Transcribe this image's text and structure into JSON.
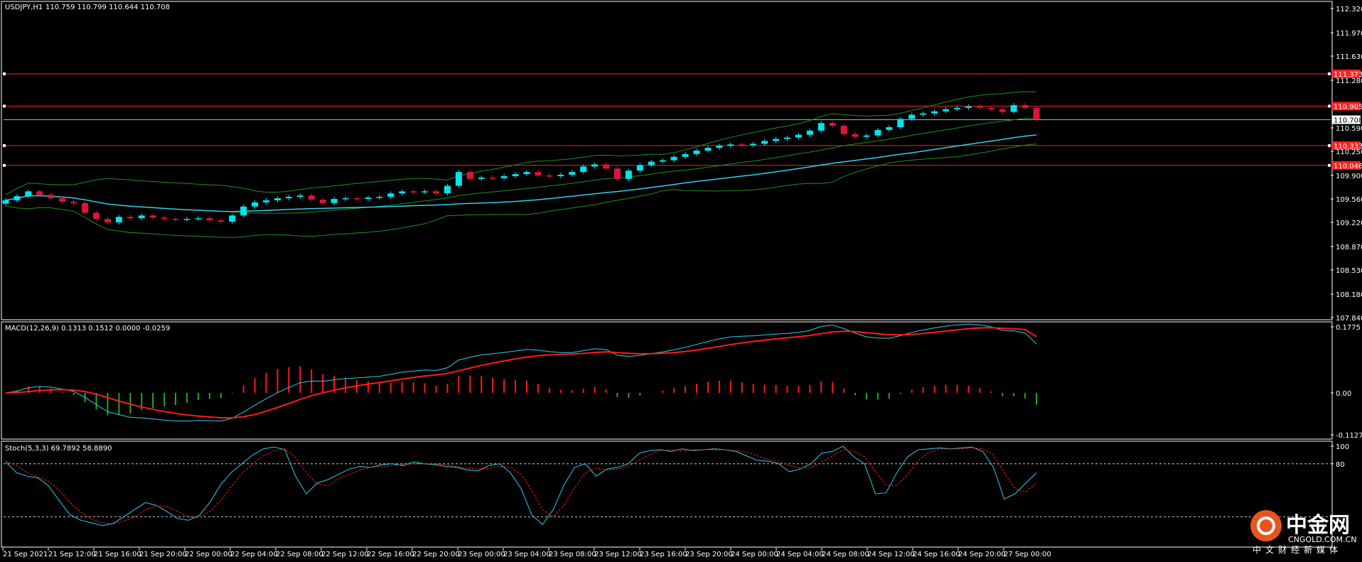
{
  "colors": {
    "background": "#000000",
    "frame": "#ffffff",
    "bull_candle": "#00e5ee",
    "bear_candle": "#dc143c",
    "ma_line": "#33ccee",
    "bands": "#1f8f1f",
    "hline": "#ff2020",
    "current_line": "#9fb8c8",
    "macd_main": "#33ccee",
    "macd_signal": "#ff1a1a",
    "hist_pos": "#ff1a1a",
    "hist_neg": "#1faa1f",
    "stoch_main": "#33ccee",
    "stoch_signal": "#ff1a1a",
    "watermark_accent": "#e8541c"
  },
  "header": {
    "symbol_label": "USDJPY,H1",
    "ohlc_label": "110.759 110.799 110.644 110.708"
  },
  "macd_panel": {
    "label": "MACD(12,26,9) 0.1313 0.1512 0.0000 -0.0259"
  },
  "stoch_panel": {
    "label": "Stoch(5,3,3) 69.7892 58.8890"
  },
  "watermark": {
    "name": "中金网",
    "domain": "CNGOLD.COM.CN",
    "sub": "中文财经新媒体"
  },
  "chart_data": [
    {
      "type": "candlestick",
      "title": "USDJPY,H1",
      "ylim": [
        107.84,
        112.32
      ],
      "y_ticks": [
        "112.320",
        "111.970",
        "111.630",
        "111.280",
        "110.590",
        "110.250",
        "109.900",
        "109.560",
        "109.220",
        "108.870",
        "108.530",
        "108.180",
        "107.840"
      ],
      "x_ticks": [
        "21 Sep 2021",
        "21 Sep 12:00",
        "21 Sep 16:00",
        "21 Sep 20:00",
        "22 Sep 00:00",
        "22 Sep 04:00",
        "22 Sep 08:00",
        "22 Sep 12:00",
        "22 Sep 16:00",
        "22 Sep 20:00",
        "23 Sep 00:00",
        "23 Sep 04:00",
        "23 Sep 08:00",
        "23 Sep 12:00",
        "23 Sep 16:00",
        "23 Sep 20:00",
        "24 Sep 00:00",
        "24 Sep 04:00",
        "24 Sep 08:00",
        "24 Sep 12:00",
        "24 Sep 16:00",
        "24 Sep 20:00",
        "27 Sep 00:00"
      ],
      "current_price": 110.708,
      "current_price_label": "110.708",
      "horizontal_levels": [
        {
          "value": 111.373,
          "label": "111.373"
        },
        {
          "value": 110.905,
          "label": "110.905"
        },
        {
          "value": 110.333,
          "label": "110.333"
        },
        {
          "value": 110.046,
          "label": "110.046"
        }
      ],
      "close": [
        109.54,
        109.6,
        109.67,
        109.62,
        109.57,
        109.52,
        109.5,
        109.36,
        109.27,
        109.22,
        109.3,
        109.28,
        109.32,
        109.29,
        109.27,
        109.26,
        109.27,
        109.28,
        109.25,
        109.23,
        109.32,
        109.45,
        109.51,
        109.54,
        109.57,
        109.59,
        109.61,
        109.55,
        109.5,
        109.56,
        109.57,
        109.56,
        109.58,
        109.59,
        109.64,
        109.67,
        109.66,
        109.67,
        109.64,
        109.75,
        109.95,
        109.85,
        109.87,
        109.86,
        109.89,
        109.92,
        109.95,
        109.9,
        109.89,
        109.91,
        109.95,
        110.03,
        110.06,
        110.0,
        109.85,
        109.97,
        110.05,
        110.1,
        110.12,
        110.17,
        110.21,
        110.26,
        110.3,
        110.33,
        110.35,
        110.34,
        110.36,
        110.4,
        110.43,
        110.45,
        110.49,
        110.55,
        110.66,
        110.62,
        110.5,
        110.46,
        110.48,
        110.56,
        110.6,
        110.72,
        110.78,
        110.8,
        110.83,
        110.86,
        110.88,
        110.9,
        110.88,
        110.86,
        110.82,
        110.92,
        110.88,
        110.708
      ]
    },
    {
      "type": "macd",
      "title": "MACD(12,26,9)",
      "values": {
        "main": 0.1313,
        "signal": 0.1512,
        "histogram": -0.0259
      },
      "y_ticks": [
        "0.1775",
        "0.00",
        "-0.1127"
      ],
      "ylim": [
        -0.1127,
        0.1775
      ]
    },
    {
      "type": "stochastic",
      "title": "Stoch(5,3,3)",
      "values": {
        "main": 69.7892,
        "signal": 58.889
      },
      "y_ticks": [
        "100",
        "80"
      ],
      "levels": [
        80,
        20
      ],
      "ylim": [
        0,
        100
      ],
      "main": [
        82,
        70,
        66,
        64,
        55,
        38,
        22,
        16,
        13,
        10,
        12,
        20,
        28,
        36,
        33,
        26,
        18,
        16,
        21,
        36,
        56,
        70,
        80,
        90,
        97,
        99,
        96,
        66,
        46,
        58,
        62,
        68,
        74,
        77,
        76,
        79,
        80,
        78,
        82,
        80,
        79,
        77,
        76,
        73,
        72,
        78,
        80,
        70,
        52,
        22,
        11,
        28,
        56,
        76,
        80,
        66,
        74,
        76,
        80,
        92,
        95,
        96,
        94,
        97,
        95,
        96,
        97,
        96,
        94,
        89,
        84,
        83,
        80,
        71,
        74,
        80,
        92,
        94,
        100,
        88,
        80,
        46,
        47,
        70,
        88,
        96,
        97,
        98,
        97,
        98,
        99,
        94,
        76,
        40,
        46,
        58,
        69.79
      ],
      "signal": [
        83,
        78,
        70,
        65,
        60,
        50,
        36,
        25,
        17,
        13,
        12,
        15,
        20,
        28,
        32,
        32,
        26,
        20,
        19,
        26,
        38,
        54,
        69,
        80,
        89,
        95,
        97,
        87,
        70,
        57,
        55,
        63,
        68,
        73,
        76,
        77,
        78,
        79,
        80,
        80,
        80,
        79,
        77,
        75,
        74,
        75,
        77,
        76,
        68,
        50,
        28,
        20,
        33,
        53,
        70,
        75,
        73,
        74,
        77,
        84,
        91,
        95,
        96,
        95,
        96,
        96,
        96,
        96,
        95,
        93,
        89,
        85,
        82,
        78,
        75,
        76,
        82,
        89,
        96,
        94,
        88,
        71,
        56,
        55,
        68,
        84,
        93,
        97,
        97,
        97,
        98,
        97,
        90,
        70,
        52,
        48,
        58.89
      ]
    }
  ]
}
